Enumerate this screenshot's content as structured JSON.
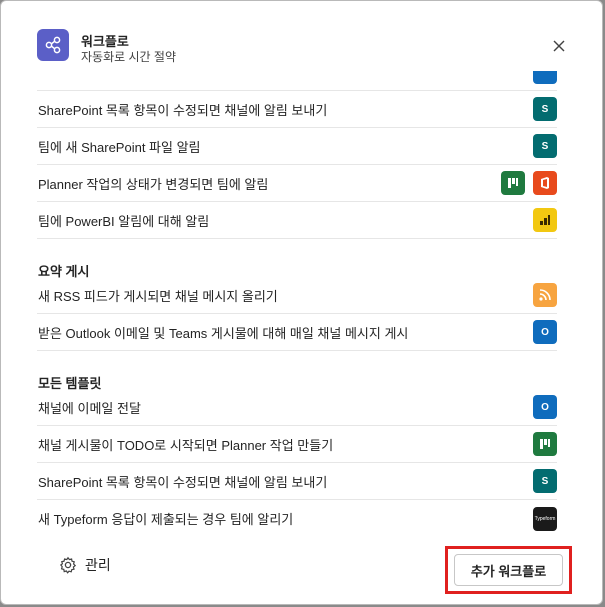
{
  "header": {
    "title": "워크플로",
    "subtitle": "자동화로 시간 절약"
  },
  "rows_top": [
    {
      "label": "SharePoint 목록 항목이 수정되면 채널에 알림 보내기",
      "icons": [
        "sharepoint-icon"
      ]
    },
    {
      "label": "팀에 새 SharePoint 파일 알림",
      "icons": [
        "sharepoint-icon"
      ]
    },
    {
      "label": "Planner 작업의 상태가 변경되면 팀에 알림",
      "icons": [
        "planner-icon",
        "office-icon"
      ]
    },
    {
      "label": "팀에 PowerBI 알림에 대해 알림",
      "icons": [
        "powerbi-icon"
      ]
    }
  ],
  "section_summary": {
    "title": "요약 게시",
    "rows": [
      {
        "label": "새 RSS 피드가 게시되면 채널 메시지 올리기",
        "icons": [
          "rss-icon"
        ]
      },
      {
        "label": "받은 Outlook 이메일 및 Teams 게시물에 대해 매일 채널 메시지 게시",
        "icons": [
          "outlook-icon"
        ]
      }
    ]
  },
  "section_all": {
    "title": "모든 템플릿",
    "rows": [
      {
        "label": "채널에 이메일 전달",
        "icons": [
          "outlook-icon"
        ]
      },
      {
        "label": "채널 게시물이 TODO로 시작되면 Planner 작업 만들기",
        "icons": [
          "planner-icon"
        ]
      },
      {
        "label": "SharePoint 목록 항목이 수정되면 채널에 알림 보내기",
        "icons": [
          "sharepoint-icon"
        ]
      },
      {
        "label": "새 Typeform 응답이 제출되는 경우 팀에 알리기",
        "icons": [
          "typeform-icon"
        ]
      }
    ]
  },
  "typeform_icon_text": "Typeform",
  "footer": {
    "manage_label": "관리",
    "add_button_label": "추가 워크플로"
  },
  "colors": {
    "accent": "#5b5fc7",
    "highlight_box": "#e0201f"
  }
}
